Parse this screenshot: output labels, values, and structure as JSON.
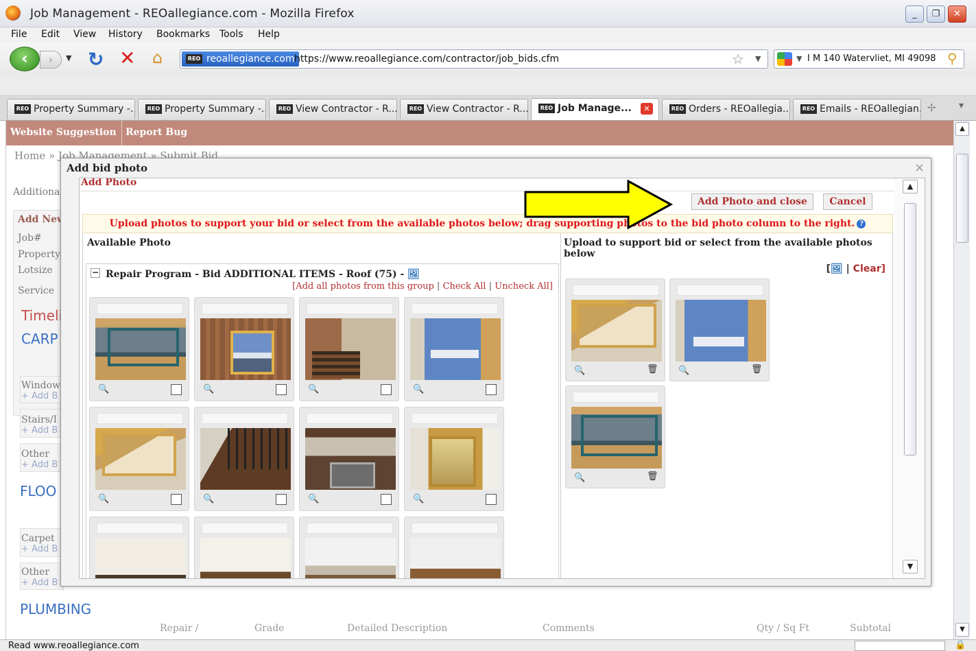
{
  "window": {
    "title": "Job Management - REOallegiance.com - Mozilla Firefox",
    "controls": {
      "minimize": "_",
      "restore": "❐",
      "close": "✕"
    }
  },
  "menu": [
    "File",
    "Edit",
    "View",
    "History",
    "Bookmarks",
    "Tools",
    "Help"
  ],
  "nav": {
    "site_identity": "reoallegiance.com",
    "url": "https://www.reoallegiance.com/contractor/job_bids.cfm",
    "search_value": "I M 140  Watervliet, MI 49098"
  },
  "favicon_text": "REO",
  "tabs": [
    {
      "label": "Property Summary -..."
    },
    {
      "label": "Property Summary -..."
    },
    {
      "label": "View Contractor - R..."
    },
    {
      "label": "View Contractor - R..."
    },
    {
      "label": "Job Manage...",
      "active": true
    },
    {
      "label": "Orders - REOallegia..."
    },
    {
      "label": "Emails - REOallegian..."
    }
  ],
  "page": {
    "topbar": [
      "Website Suggestion",
      "Report Bug"
    ],
    "breadcrumb": "Home  »  Job Management  »  Submit Bid",
    "labels": {
      "additional": "Additional",
      "add_new": "Add New",
      "job": "Job#",
      "property": "Property",
      "lotsize": "Lotsize",
      "service": "Service",
      "timeline": "Timelir",
      "carp": "CARP",
      "window": "Window",
      "stairs": "Stairs/I",
      "other1": "Other",
      "floo": "FLOO",
      "carpet": "Carpet",
      "other2": "Other",
      "add_b": "+ Add B",
      "plumbing": "PLUMBING"
    },
    "columns": [
      "Repair /",
      "Grade",
      "Detailed Description",
      "Comments",
      "Qty / Sq Ft",
      "Subtotal"
    ]
  },
  "status_text": "Read www.reoallegiance.com",
  "modal": {
    "title": "Add bid photo",
    "close": "×",
    "section": "Add Photo",
    "add_close_label": "Add Photo and close",
    "cancel_label": "Cancel",
    "instruction": "Upload photos to support your bid or select from the available photos below; drag supporting photos to the bid photo column to the right.",
    "help": "?",
    "available_title": "Available Photo",
    "group": {
      "toggle": "−",
      "title": "Repair Program - Bid ADDITIONAL ITEMS - Roof (75) -",
      "add_all": "[Add all photos from this group",
      "check_all": "Check All",
      "uncheck_all": "Uncheck All]"
    },
    "right_title": "Upload to support bid or select from the available photos below",
    "clear": "Clear]"
  },
  "colors": {
    "accent_red": "#b03030",
    "instruction_red": "#e0161b",
    "site_bar": "#c1897b",
    "arrow_yellow": "#ffff00"
  },
  "icons": [
    "firefox-logo-icon",
    "back-arrow-icon",
    "forward-arrow-icon",
    "reload-icon",
    "stop-icon",
    "home-icon",
    "bookmark-star-icon",
    "google-icon",
    "search-go-icon",
    "zoom-icon",
    "trash-icon",
    "help-icon",
    "upload-icon",
    "lock-icon"
  ]
}
